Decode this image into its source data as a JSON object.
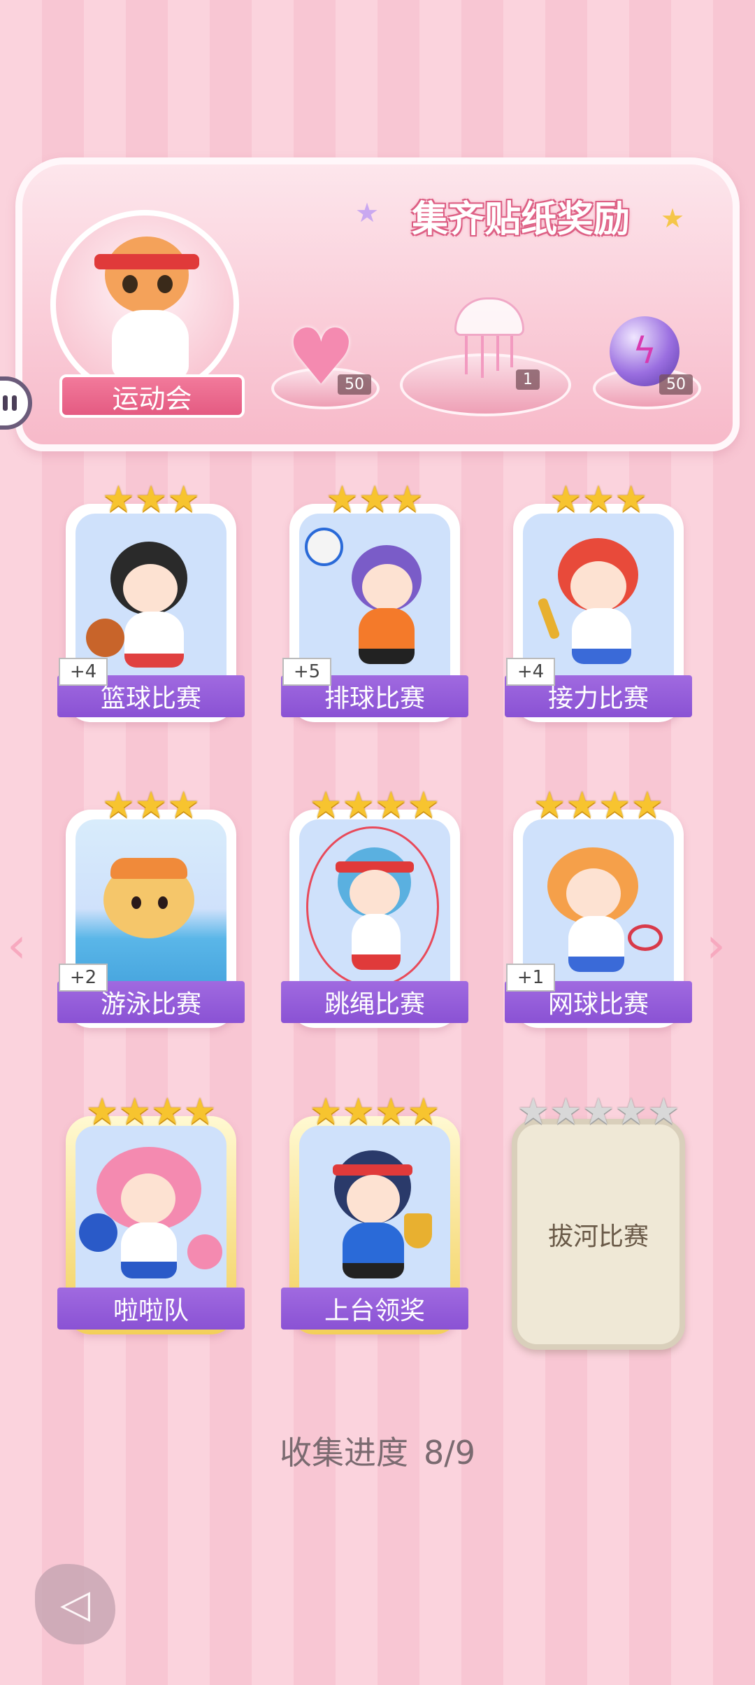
{
  "banner": {
    "title": "集齐贴纸奖励",
    "event_name": "运动会",
    "rewards": [
      {
        "icon": "heart-gem-icon",
        "count": "50"
      },
      {
        "icon": "jellyfish-icon",
        "count": "1"
      },
      {
        "icon": "energy-orb-icon",
        "count": "50"
      }
    ]
  },
  "cards": [
    {
      "label": "篮球比赛",
      "stars": 3,
      "plus": "+4",
      "theme": "basketball"
    },
    {
      "label": "排球比赛",
      "stars": 3,
      "plus": "+5",
      "theme": "volleyball"
    },
    {
      "label": "接力比赛",
      "stars": 3,
      "plus": "+4",
      "theme": "relay"
    },
    {
      "label": "游泳比赛",
      "stars": 3,
      "plus": "+2",
      "theme": "swimming"
    },
    {
      "label": "跳绳比赛",
      "stars": 4,
      "plus": "",
      "theme": "jump-rope"
    },
    {
      "label": "网球比赛",
      "stars": 4,
      "plus": "+1",
      "theme": "tennis"
    },
    {
      "label": "啦啦队",
      "stars": 4,
      "plus": "",
      "theme": "cheerleader"
    },
    {
      "label": "上台领奖",
      "stars": 4,
      "plus": "",
      "theme": "award"
    },
    {
      "label": "拔河比赛",
      "stars": 5,
      "plus": "",
      "theme": "tug-of-war",
      "locked": true
    }
  ],
  "progress": {
    "label": "收集进度",
    "value": "8/9"
  },
  "colors": {
    "accent_pink": "#e45b82",
    "label_purple": "#8a52d4",
    "star_gold": "#f7c42f"
  }
}
